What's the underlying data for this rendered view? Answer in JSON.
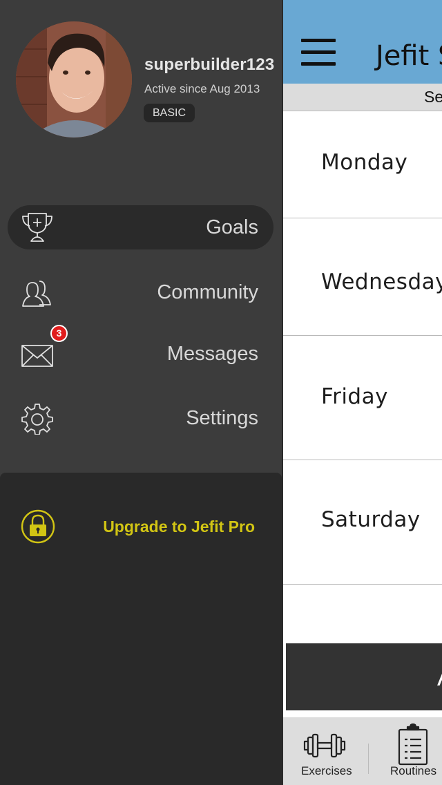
{
  "profile": {
    "username": "superbuilder123",
    "active_since": "Active since Aug 2013",
    "membership": "BASIC"
  },
  "menu": {
    "goals": "Goals",
    "community": "Community",
    "messages": "Messages",
    "messages_count": "3",
    "settings": "Settings"
  },
  "upgrade": {
    "label": "Upgrade to Jefit Pro",
    "color": "#d2c514"
  },
  "main": {
    "title": "Jefit S",
    "subtitle": "Se",
    "days": [
      "Monday",
      "Wednesday",
      "Friday",
      "Saturday"
    ],
    "action_label": "A"
  },
  "tabs": {
    "exercises": "Exercises",
    "routines": "Routines"
  },
  "icons": {
    "goals": "trophy-icon",
    "community": "users-icon",
    "messages": "envelope-icon",
    "settings": "gear-icon",
    "upgrade": "lock-icon",
    "menu": "hamburger-icon",
    "exercises": "dumbbell-icon",
    "routines": "clipboard-icon"
  },
  "colors": {
    "drawer_bg": "#3c3c3c",
    "topbar_blue": "#69a8d3",
    "badge_red": "#e11d1d"
  }
}
